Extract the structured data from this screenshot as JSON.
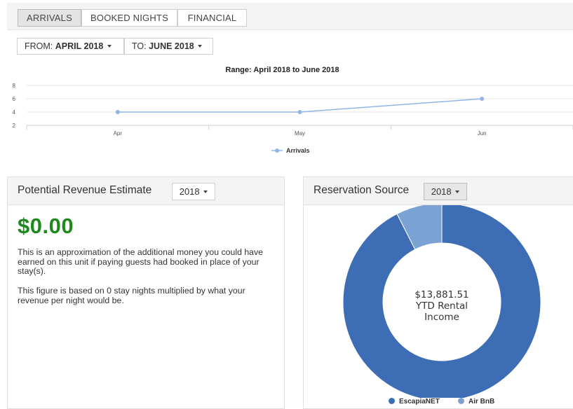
{
  "tabs": [
    "ARRIVALS",
    "BOOKED NIGHTS",
    "FINANCIAL"
  ],
  "active_tab": "ARRIVALS",
  "range": {
    "from_prefix": "FROM: ",
    "from_value": "APRIL 2018",
    "to_prefix": "TO: ",
    "to_value": "JUNE 2018"
  },
  "chart_data": {
    "type": "line",
    "title": "Range: April 2018 to June 2018",
    "categories": [
      "Apr",
      "May",
      "Jun"
    ],
    "series": [
      {
        "name": "Arrivals",
        "values": [
          4,
          4,
          6
        ],
        "color": "#90b6e8"
      }
    ],
    "y_ticks": [
      "2",
      "4",
      "6",
      "8"
    ],
    "ylim": [
      2,
      8
    ],
    "grid": true,
    "legend_position": "bottom"
  },
  "revenue_panel": {
    "title": "Potential Revenue Estimate",
    "year": "2018",
    "amount": "$0.00",
    "amount_color": "#1e8a1e",
    "desc1": "This is an approximation of the additional money you could have earned on this unit if paying guests had booked in place of your stay(s).",
    "desc2": "This figure is based on 0 stay nights multiplied by what your revenue per night would be."
  },
  "source_panel": {
    "title": "Reservation Source",
    "year": "2018",
    "center_line1": "$13,881.51",
    "center_line2": "YTD Rental",
    "center_line3": "Income",
    "donut": [
      {
        "name": "EscapiaNET",
        "percent": 92.5,
        "color": "#3d6db5"
      },
      {
        "name": "Air BnB",
        "percent": 7.5,
        "color": "#7aa3d4"
      }
    ]
  }
}
